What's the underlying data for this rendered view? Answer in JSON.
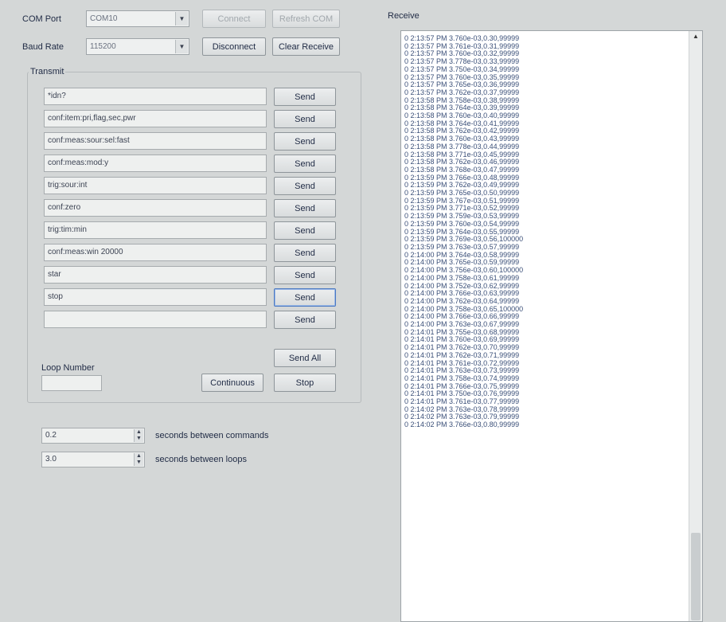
{
  "com_port": {
    "label": "COM Port",
    "value": "COM10"
  },
  "baud_rate": {
    "label": "Baud Rate",
    "value": "115200"
  },
  "buttons": {
    "connect": "Connect",
    "refresh_com": "Refresh COM",
    "disconnect": "Disconnect",
    "clear_receive": "Clear Receive"
  },
  "transmit": {
    "title": "Transmit",
    "send_label": "Send",
    "commands": [
      "*idn?",
      "conf:item:pri,flag,sec,pwr",
      "conf:meas:sour:sel:fast",
      "conf:meas:mod:y",
      "trig:sour:int",
      "conf:zero",
      "trig:tim:min",
      "conf:meas:win 20000",
      "star",
      "stop",
      ""
    ],
    "send_all": "Send All",
    "loop_number_label": "Loop Number",
    "loop_number_value": "",
    "continuous": "Continuous",
    "stop": "Stop"
  },
  "timing": {
    "between_commands_value": "0.2",
    "between_commands_label": "seconds between commands",
    "between_loops_value": "3.0",
    "between_loops_label": "seconds between loops"
  },
  "receive": {
    "title": "Receive",
    "lines": [
      "0 2:13:57 PM 3.760e-03,0.30,99999",
      "0 2:13:57 PM 3.761e-03,0.31,99999",
      "0 2:13:57 PM 3.760e-03,0.32,99999",
      "0 2:13:57 PM 3.778e-03,0.33,99999",
      "0 2:13:57 PM 3.750e-03,0.34,99999",
      "0 2:13:57 PM 3.760e-03,0.35,99999",
      "0 2:13:57 PM 3.765e-03,0.36,99999",
      "0 2:13:57 PM 3.762e-03,0.37,99999",
      "0 2:13:58 PM 3.758e-03,0.38,99999",
      "0 2:13:58 PM 3.764e-03,0.39,99999",
      "0 2:13:58 PM 3.760e-03,0.40,99999",
      "0 2:13:58 PM 3.764e-03,0.41,99999",
      "0 2:13:58 PM 3.762e-03,0.42,99999",
      "0 2:13:58 PM 3.760e-03,0.43,99999",
      "0 2:13:58 PM 3.778e-03,0.44,99999",
      "0 2:13:58 PM 3.771e-03,0.45,99999",
      "0 2:13:58 PM 3.762e-03,0.46,99999",
      "0 2:13:58 PM 3.768e-03,0.47,99999",
      "0 2:13:59 PM 3.766e-03,0.48,99999",
      "0 2:13:59 PM 3.762e-03,0.49,99999",
      "0 2:13:59 PM 3.765e-03,0.50,99999",
      "0 2:13:59 PM 3.767e-03,0.51,99999",
      "0 2:13:59 PM 3.771e-03,0.52,99999",
      "0 2:13:59 PM 3.759e-03,0.53,99999",
      "0 2:13:59 PM 3.760e-03,0.54,99999",
      "0 2:13:59 PM 3.764e-03,0.55,99999",
      "0 2:13:59 PM 3.769e-03,0.56,100000",
      "0 2:13:59 PM 3.763e-03,0.57,99999",
      "0 2:14:00 PM 3.764e-03,0.58,99999",
      "0 2:14:00 PM 3.765e-03,0.59,99999",
      "0 2:14:00 PM 3.756e-03,0.60,100000",
      "0 2:14:00 PM 3.758e-03,0.61,99999",
      "0 2:14:00 PM 3.752e-03,0.62,99999",
      "0 2:14:00 PM 3.766e-03,0.63,99999",
      "0 2:14:00 PM 3.762e-03,0.64,99999",
      "0 2:14:00 PM 3.758e-03,0.65,100000",
      "0 2:14:00 PM 3.766e-03,0.66,99999",
      "0 2:14:00 PM 3.763e-03,0.67,99999",
      "0 2:14:01 PM 3.755e-03,0.68,99999",
      "0 2:14:01 PM 3.760e-03,0.69,99999",
      "0 2:14:01 PM 3.762e-03,0.70,99999",
      "0 2:14:01 PM 3.762e-03,0.71,99999",
      "0 2:14:01 PM 3.761e-03,0.72,99999",
      "0 2:14:01 PM 3.763e-03,0.73,99999",
      "0 2:14:01 PM 3.758e-03,0.74,99999",
      "0 2:14:01 PM 3.766e-03,0.75,99999",
      "0 2:14:01 PM 3.750e-03,0.76,99999",
      "0 2:14:01 PM 3.761e-03,0.77,99999",
      "0 2:14:02 PM 3.763e-03,0.78,99999",
      "0 2:14:02 PM 3.763e-03,0.79,99999",
      "0 2:14:02 PM 3.766e-03,0.80,99999"
    ]
  }
}
